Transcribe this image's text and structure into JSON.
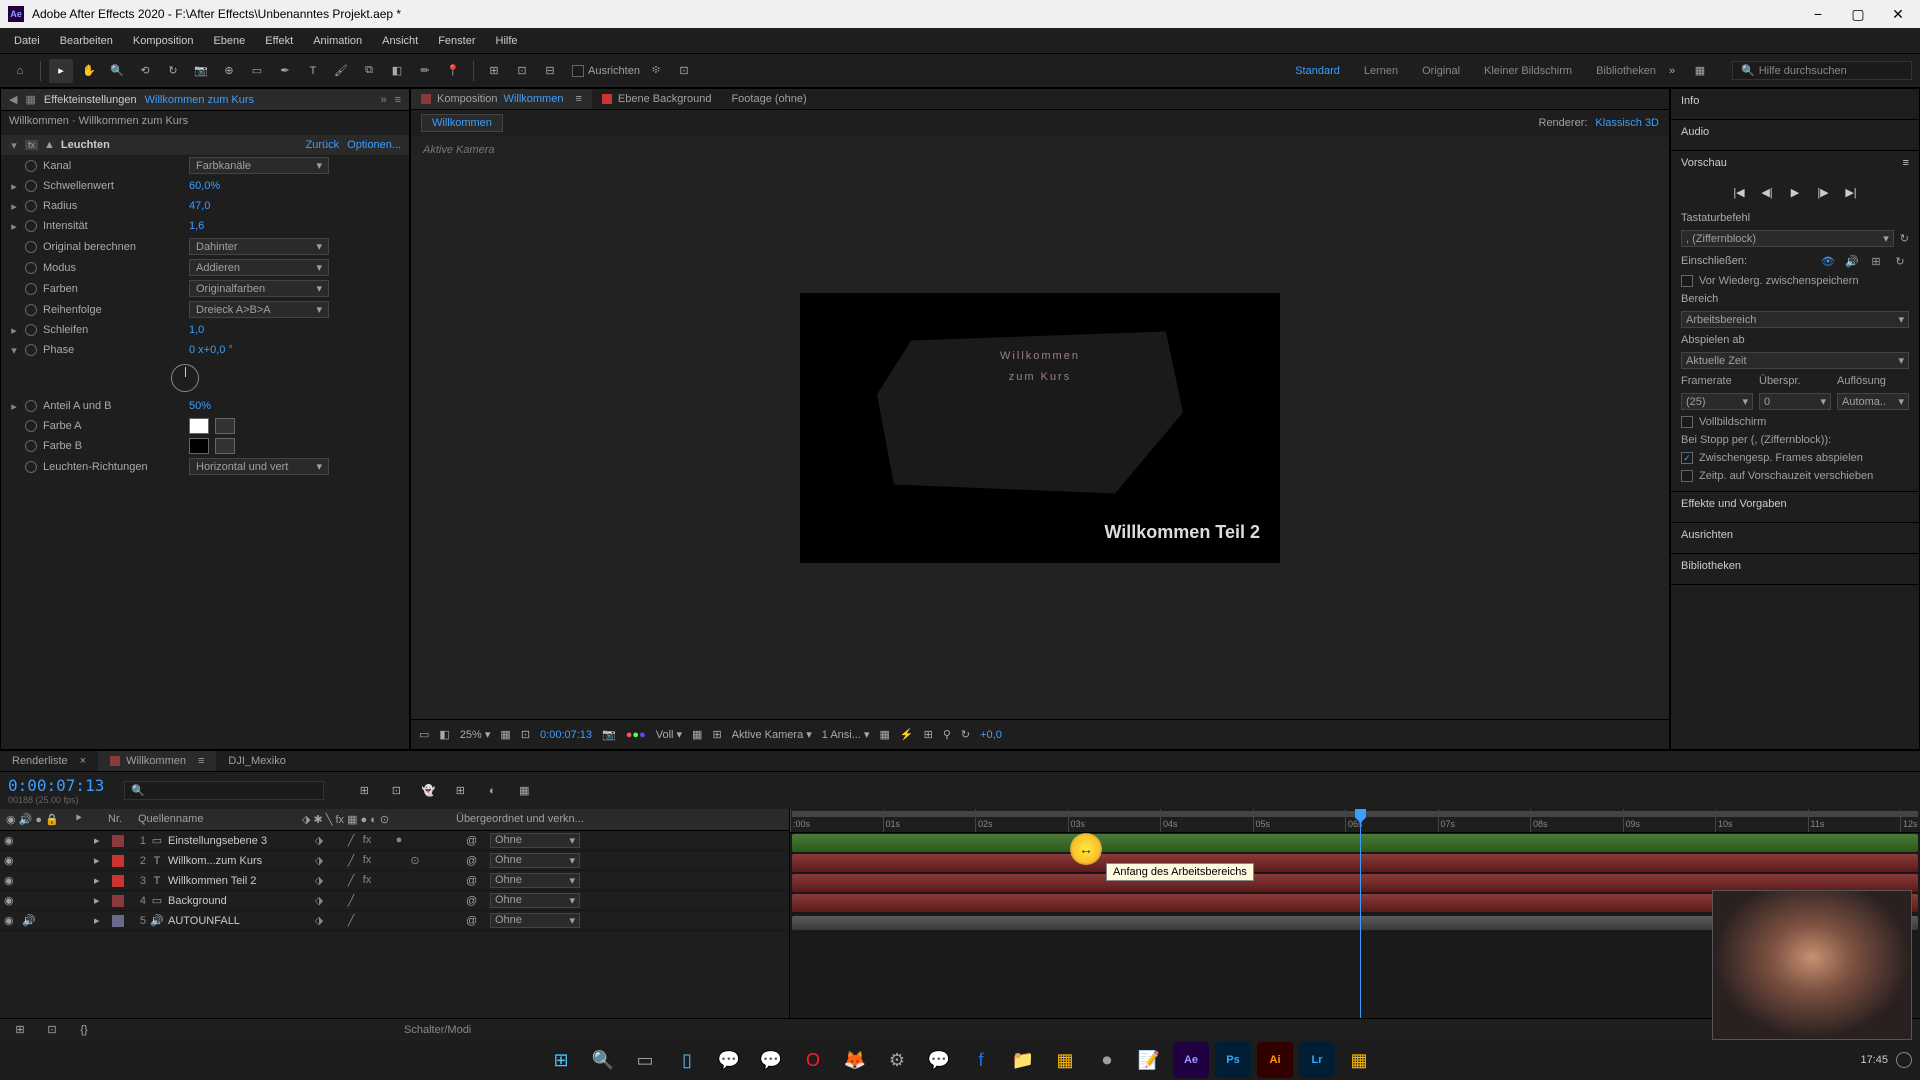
{
  "titlebar": {
    "app_abbr": "Ae",
    "title": "Adobe After Effects 2020 - F:\\After Effects\\Unbenanntes Projekt.aep *"
  },
  "menu": [
    "Datei",
    "Bearbeiten",
    "Komposition",
    "Ebene",
    "Effekt",
    "Animation",
    "Ansicht",
    "Fenster",
    "Hilfe"
  ],
  "toolbar": {
    "align_label": "Ausrichten"
  },
  "workspaces": {
    "items": [
      "Standard",
      "Lernen",
      "Original",
      "Kleiner Bildschirm",
      "Bibliotheken"
    ],
    "active": "Standard",
    "search_placeholder": "Hilfe durchsuchen"
  },
  "effects_panel": {
    "tab_label": "Effekteinstellungen",
    "tab_highlight": "Willkommen zum Kurs",
    "breadcrumb": "Willkommen · Willkommen zum Kurs",
    "effect": {
      "name": "Leuchten",
      "reset": "Zurück",
      "options": "Optionen...",
      "props": {
        "kanal": {
          "label": "Kanal",
          "value": "Farbkanäle"
        },
        "schwellenwert": {
          "label": "Schwellenwert",
          "value": "60,0",
          "unit": "%"
        },
        "radius": {
          "label": "Radius",
          "value": "47,0"
        },
        "intensitat": {
          "label": "Intensität",
          "value": "1,6"
        },
        "original": {
          "label": "Original berechnen",
          "value": "Dahinter"
        },
        "modus": {
          "label": "Modus",
          "value": "Addieren"
        },
        "farben": {
          "label": "Farben",
          "value": "Originalfarben"
        },
        "reihenfolge": {
          "label": "Reihenfolge",
          "value": "Dreieck A>B>A"
        },
        "schleifen": {
          "label": "Schleifen",
          "value": "1,0"
        },
        "phase": {
          "label": "Phase",
          "value": "0 x+0,0 °"
        },
        "anteil": {
          "label": "Anteil A und B",
          "value": "50",
          "unit": "%"
        },
        "farbe_a": {
          "label": "Farbe A"
        },
        "farbe_b": {
          "label": "Farbe B"
        },
        "richtungen": {
          "label": "Leuchten-Richtungen",
          "value": "Horizontal und vert"
        }
      }
    }
  },
  "comp_panel": {
    "tabs": [
      {
        "label": "Komposition",
        "highlight": "Willkommen",
        "active": true,
        "color": "#8a3a3a"
      },
      {
        "label": "Ebene Background",
        "active": false,
        "color": "#cc3333"
      },
      {
        "label": "Footage (ohne)",
        "active": false,
        "color": ""
      }
    ],
    "breadcrumb_item": "Willkommen",
    "renderer_label": "Renderer:",
    "renderer_value": "Klassisch 3D",
    "viewer_label": "Aktive Kamera",
    "preview": {
      "text1_line1": "Willkommen",
      "text1_line2": "zum Kurs",
      "text2": "Willkommen Teil 2"
    },
    "footer": {
      "zoom": "25%",
      "timecode": "0:00:07:13",
      "res": "Voll",
      "camera": "Aktive Kamera",
      "views": "1 Ansi...",
      "exposure": "+0,0"
    }
  },
  "right": {
    "info": "Info",
    "audio": "Audio",
    "vorschau": "Vorschau",
    "tastatur_label": "Tastaturbefehl",
    "tastatur_value": ", (Ziffernblock)",
    "einschliessen": "Einschließen:",
    "cache_label": "Vor Wiederg. zwischenspeichern",
    "bereich_label": "Bereich",
    "bereich_value": "Arbeitsbereich",
    "abspielen_label": "Abspielen ab",
    "abspielen_value": "Aktuelle Zeit",
    "framerate_label": "Framerate",
    "uberspr_label": "Überspr.",
    "auflosung_label": "Auflösung",
    "framerate_value": "(25)",
    "uberspr_value": "0",
    "auflosung_value": "Automa..",
    "vollbild": "Vollbildschirm",
    "stopp_label": "Bei Stopp per (, (Ziffernblock)):",
    "zwischen_label": "Zwischengesp. Frames abspielen",
    "zeitp_label": "Zeitp. auf Vorschauzeit verschieben",
    "effekte": "Effekte und Vorgaben",
    "ausrichten": "Ausrichten",
    "bibliotheken": "Bibliotheken"
  },
  "timeline": {
    "tabs": [
      {
        "label": "Renderliste",
        "close": true
      },
      {
        "label": "Willkommen",
        "active": true
      },
      {
        "label": "DJI_Mexiko"
      }
    ],
    "timecode": "0:00:07:13",
    "frame_info": "00188 (25.00 fps)",
    "columns": {
      "nr": "Nr.",
      "quellenname": "Quellenname",
      "parent": "Übergeordnet und verkn..."
    },
    "layers": [
      {
        "num": "1",
        "color": "#8a3a3a",
        "type": "adj",
        "name": "Einstellungsebene 3",
        "parent": "Ohne"
      },
      {
        "num": "2",
        "color": "#cc3333",
        "type": "T",
        "name": "Willkom...zum Kurs",
        "parent": "Ohne"
      },
      {
        "num": "3",
        "color": "#cc3333",
        "type": "T",
        "name": "Willkommen Teil 2",
        "parent": "Ohne"
      },
      {
        "num": "4",
        "color": "#8a3a3a",
        "type": "solid",
        "name": "Background",
        "parent": "Ohne"
      },
      {
        "num": "5",
        "color": "#6a6a8a",
        "type": "audio",
        "name": "AUTOUNFALL",
        "parent": "Ohne"
      }
    ],
    "ruler": [
      ":00s",
      "01s",
      "02s",
      "03s",
      "04s",
      "05s",
      "06s",
      "07s",
      "08s",
      "09s",
      "10s",
      "11s",
      "12s"
    ],
    "tooltip": "Anfang des Arbeitsbereichs",
    "footer_label": "Schalter/Modi"
  },
  "taskbar": {
    "time": "17:45"
  }
}
